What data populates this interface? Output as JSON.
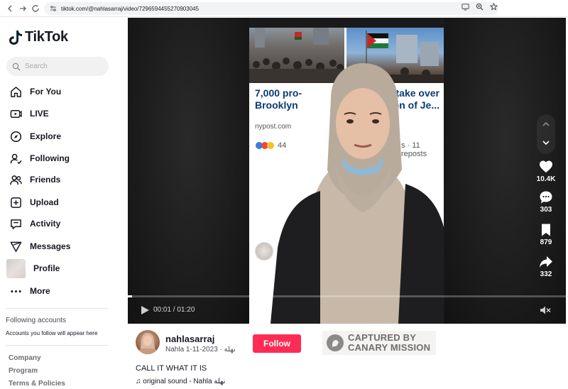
{
  "browser": {
    "url": "tiktok.com/@nahlasarraj/video/7296594455270903045"
  },
  "sidebar": {
    "logo_text": "TikTok",
    "search_placeholder": "Search",
    "nav": [
      {
        "label": "For You",
        "icon": "home-icon"
      },
      {
        "label": "LIVE",
        "icon": "live-icon"
      },
      {
        "label": "Explore",
        "icon": "compass-icon"
      },
      {
        "label": "Following",
        "icon": "following-icon"
      },
      {
        "label": "Friends",
        "icon": "friends-icon"
      },
      {
        "label": "Upload",
        "icon": "upload-icon"
      },
      {
        "label": "Activity",
        "icon": "activity-icon"
      },
      {
        "label": "Messages",
        "icon": "messages-icon"
      },
      {
        "label": "Profile",
        "icon": "profile-avatar"
      },
      {
        "label": "More",
        "icon": "more-icon"
      }
    ],
    "following_title": "Following accounts",
    "following_sub": "Accounts you follow will appear here",
    "footer": [
      "Company",
      "Program",
      "Terms & Policies"
    ]
  },
  "video": {
    "article_headline": "7,000 pro-                    ers take over Brooklyn                  ation of Je...",
    "article_line1": "7,000 pro-",
    "article_line1b": "ers take over",
    "article_line2": "Brooklyn",
    "article_line2b": "ation of Je...",
    "source": "nypost.com",
    "likes_partial": "44",
    "reposts_partial": "s  ·  11 reposts",
    "progress": 0.01,
    "time": "00:01 / 01:20"
  },
  "actions": {
    "likes": "10.4K",
    "comments": "303",
    "saves": "879",
    "shares": "332"
  },
  "post": {
    "author": "nahlasarraj",
    "meta": "Nahla نهلة · 2023-11-1",
    "follow_label": "Follow",
    "caption": "CALL IT WHAT IT IS",
    "sound": "♫ original sound - Nahla نهلة"
  },
  "watermark": {
    "line1": "CAPTURED BY",
    "line2": "CANARY MISSION"
  },
  "colors": {
    "accent": "#fe2c55",
    "text": "#161823"
  }
}
